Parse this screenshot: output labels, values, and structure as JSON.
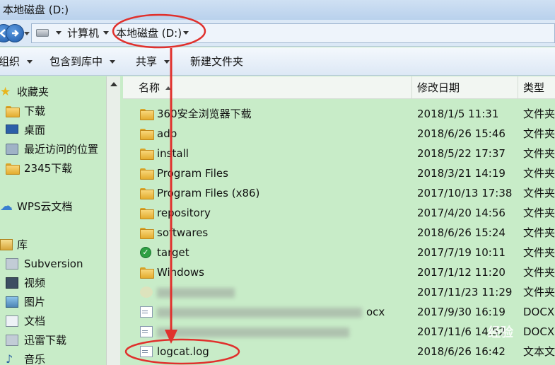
{
  "window": {
    "title": "本地磁盘 (D:)"
  },
  "address": {
    "segments": [
      "计算机",
      "本地磁盘 (D:)"
    ]
  },
  "toolbar": {
    "organize": "组织",
    "include_in_library": "包含到库中",
    "share": "共享",
    "new_folder": "新建文件夹"
  },
  "nav": {
    "favorites": {
      "label": "收藏夹",
      "items": [
        "下载",
        "桌面",
        "最近访问的位置",
        "2345下载"
      ]
    },
    "wps": "WPS云文档",
    "libraries": {
      "label": "库",
      "items": [
        "Subversion",
        "视频",
        "图片",
        "文档",
        "迅雷下载",
        "音乐"
      ]
    }
  },
  "columns": {
    "name": "名称",
    "date": "修改日期",
    "type": "类型"
  },
  "files": [
    {
      "name": "360安全浏览器下载",
      "date": "2018/1/5 11:31",
      "type": "文件夹",
      "icon": "folder-icon"
    },
    {
      "name": "adb",
      "date": "2018/6/26 15:46",
      "type": "文件夹",
      "icon": "folder-icon"
    },
    {
      "name": "install",
      "date": "2018/5/22 17:37",
      "type": "文件夹",
      "icon": "folder-icon"
    },
    {
      "name": "Program Files",
      "date": "2018/3/21 14:19",
      "type": "文件夹",
      "icon": "folder-icon"
    },
    {
      "name": "Program Files (x86)",
      "date": "2017/10/13 17:38",
      "type": "文件夹",
      "icon": "folder-icon"
    },
    {
      "name": "repository",
      "date": "2017/4/20 14:56",
      "type": "文件夹",
      "icon": "folder-icon"
    },
    {
      "name": "softwares",
      "date": "2018/6/26 15:24",
      "type": "文件夹",
      "icon": "folder-icon"
    },
    {
      "name": "target",
      "date": "2017/7/19 10:11",
      "type": "文件夹",
      "icon": "synced-folder-icon"
    },
    {
      "name": "Windows",
      "date": "2017/1/12 11:20",
      "type": "文件夹",
      "icon": "folder-icon"
    },
    {
      "name": "",
      "date": "2017/11/23 11:29",
      "type": "文件夹",
      "icon": "folder-icon"
    },
    {
      "name": "ocx",
      "date": "2017/9/30 16:19",
      "type": "DOCX",
      "icon": "document-icon"
    },
    {
      "name": "",
      "date": "2017/11/6 14:52",
      "type": "DOCX",
      "icon": "document-icon"
    },
    {
      "name": "logcat.log",
      "date": "2018/6/26 16:42",
      "type": "文本文",
      "icon": "text-file-icon"
    }
  ],
  "watermark": "经验",
  "colors": {
    "annotation": "#e0302c",
    "list_background": "#c8ecc8"
  }
}
